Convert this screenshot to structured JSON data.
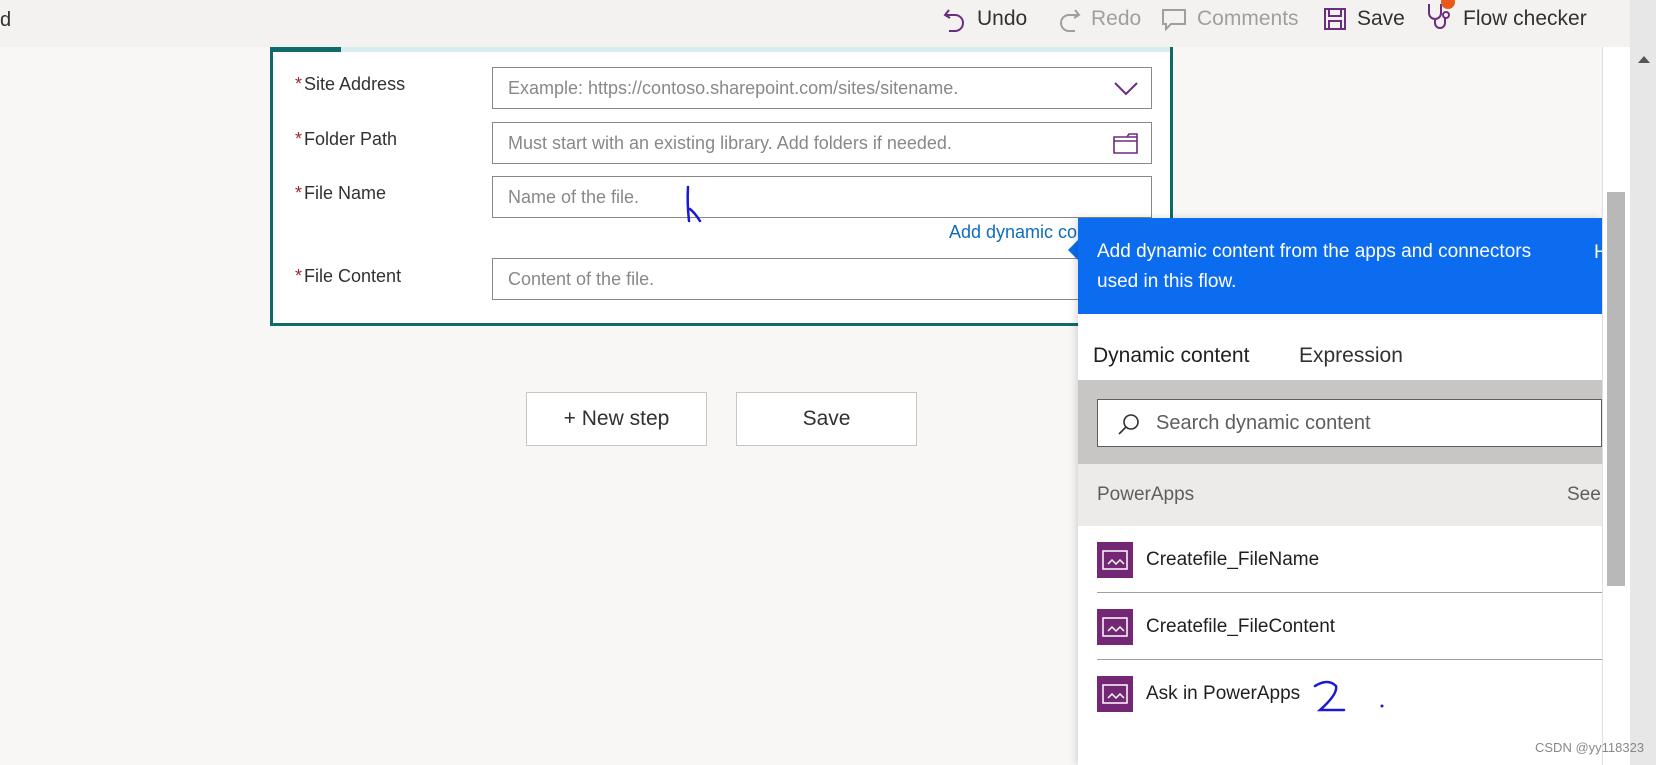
{
  "topbar": {
    "edge_text": "d",
    "undo_label": "Undo",
    "redo_label": "Redo",
    "comments_label": "Comments",
    "save_label": "Save",
    "flow_checker_label": "Flow checker"
  },
  "form": {
    "fields": [
      {
        "label": "Site Address",
        "required_mark": "*",
        "placeholder": "Example: https://contoso.sharepoint.com/sites/sitename.",
        "icon": "chevron-down-icon"
      },
      {
        "label": "Folder Path",
        "required_mark": "*",
        "placeholder": "Must start with an existing library. Add folders if needed.",
        "icon": "folder-icon"
      },
      {
        "label": "File Name",
        "required_mark": "*",
        "placeholder": "Name of the file.",
        "icon": ""
      },
      {
        "label": "File Content",
        "required_mark": "*",
        "placeholder": "Content of the file.",
        "icon": ""
      }
    ],
    "add_dynamic_link": "Add dynamic co"
  },
  "buttons": {
    "new_step": "+ New step",
    "save": "Save"
  },
  "dynamic_panel": {
    "header": "Add dynamic content from the apps and connectors used in this flow.",
    "header_right": "H",
    "tabs": [
      "Dynamic content",
      "Expression"
    ],
    "active_tab": "Dynamic content",
    "search_placeholder": "Search dynamic content",
    "group_name": "PowerApps",
    "see_more": "See l",
    "items": [
      "Createfile_FileName",
      "Createfile_FileContent",
      "Ask in PowerApps"
    ]
  },
  "annotations": {
    "mark_1": "1",
    "mark_2": "2"
  },
  "watermark": "CSDN @yy118323",
  "colors": {
    "accent_teal": "#0e6b69",
    "panel_blue": "#0b6cf0",
    "powerapps_purple": "#742774",
    "link_blue": "#0f6cbd",
    "required_red": "#a4262c"
  }
}
